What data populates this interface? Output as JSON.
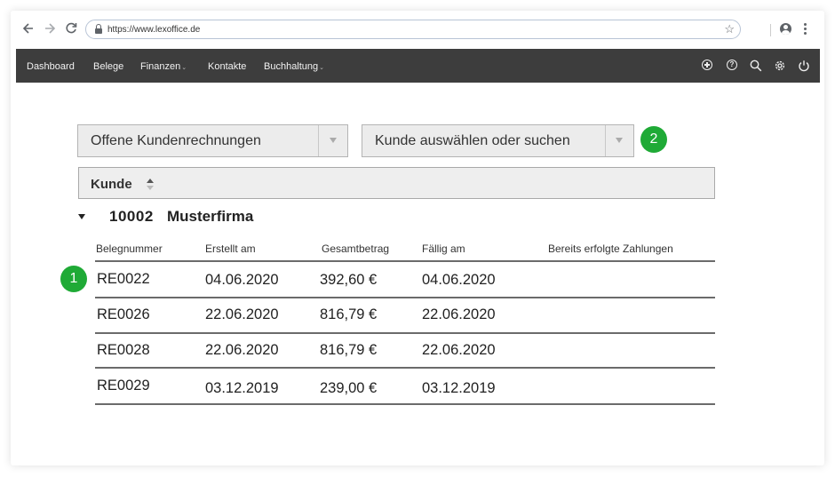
{
  "browser": {
    "url": "https://www.lexoffice.de",
    "back_icon": "arrow-left-icon",
    "forward_icon": "arrow-right-icon",
    "reload_icon": "reload-icon",
    "lock_icon": "lock-icon",
    "bookmark_icon": "star-icon",
    "profile_icon": "account-icon",
    "menu_icon": "kebab-menu-icon"
  },
  "topnav": {
    "items": [
      {
        "label": "Dashboard",
        "has_caret": false
      },
      {
        "label": "Belege",
        "has_caret": false
      },
      {
        "label": "Finanzen",
        "has_caret": true,
        "caret": "⌄"
      },
      {
        "label": "Kontakte",
        "has_caret": false
      },
      {
        "label": "Buchhaltung",
        "has_caret": true,
        "caret": "⌄"
      }
    ],
    "icons": [
      "add-circle-icon",
      "help-icon",
      "search-icon",
      "settings-icon",
      "power-icon"
    ],
    "background_color": "#3d3d3d"
  },
  "filters": {
    "invoice_filter": {
      "selected": "Offene Kundenrechnungen"
    },
    "customer_filter": {
      "placeholder": "Kunde auswählen oder suchen"
    }
  },
  "badges": {
    "step_1": "1",
    "step_2": "2",
    "color": "#1faa36"
  },
  "sort": {
    "label": "Kunde"
  },
  "group": {
    "customer_id": "10002",
    "customer_name": "Musterfirma"
  },
  "table": {
    "headers": [
      "Belegnummer",
      "Erstellt am",
      "Gesamtbetrag",
      "Fällig am",
      "Bereits erfolgte Zahlungen"
    ],
    "rows": [
      {
        "belegnummer": "RE0022",
        "erstellt": "04.06.2020",
        "betrag": "392,60 €",
        "faellig": "04.06.2020",
        "zahlungen": ""
      },
      {
        "belegnummer": "RE0026",
        "erstellt": "22.06.2020",
        "betrag": "816,79 €",
        "faellig": "22.06.2020",
        "zahlungen": ""
      },
      {
        "belegnummer": "RE0028",
        "erstellt": "22.06.2020",
        "betrag": "816,79 €",
        "faellig": "22.06.2020",
        "zahlungen": ""
      },
      {
        "belegnummer": "RE0029",
        "erstellt": "03.12.2019",
        "betrag": "239,00 €",
        "faellig": "03.12.2019",
        "zahlungen": ""
      }
    ]
  }
}
